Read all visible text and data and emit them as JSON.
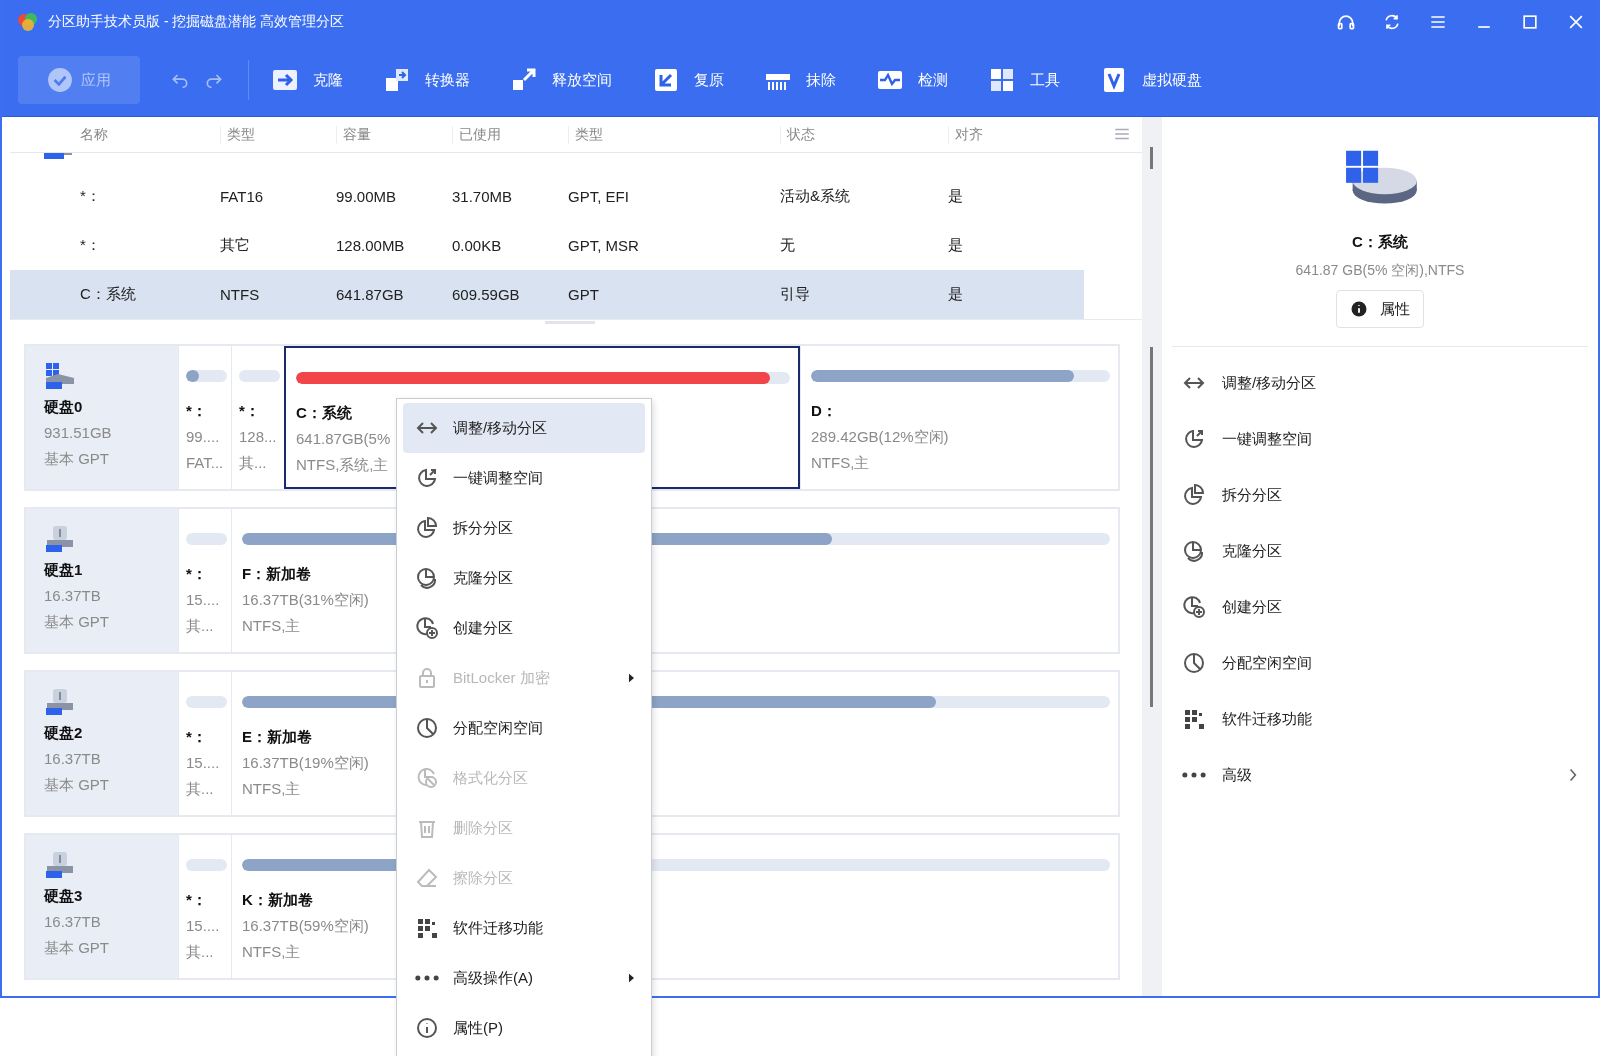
{
  "window": {
    "title": "分区助手技术员版 - 挖掘磁盘潜能 高效管理分区"
  },
  "toolbar": {
    "apply": {
      "label": "应用",
      "disabled": true
    },
    "tools": [
      {
        "label": "克隆"
      },
      {
        "label": "转换器"
      },
      {
        "label": "释放空间"
      },
      {
        "label": "复原"
      },
      {
        "label": "抹除"
      },
      {
        "label": "检测"
      },
      {
        "label": "工具"
      },
      {
        "label": "虚拟硬盘"
      }
    ]
  },
  "table": {
    "columns": [
      "名称",
      "类型",
      "容量",
      "已使用",
      "类型",
      "状态",
      "对齐"
    ],
    "rows": [
      {
        "cells": [
          "*：",
          "FAT16",
          "99.00MB",
          "31.70MB",
          "GPT, EFI",
          "活动&系统",
          "是"
        ],
        "selected": false
      },
      {
        "cells": [
          "*：",
          "其它",
          "128.00MB",
          "0.00KB",
          "GPT, MSR",
          "无",
          "是"
        ],
        "selected": false
      },
      {
        "cells": [
          "C：系统",
          "NTFS",
          "641.87GB",
          "609.59GB",
          "GPT",
          "引导",
          "是"
        ],
        "selected": true
      }
    ]
  },
  "disks": [
    {
      "name": "硬盘0",
      "size": "931.51GB",
      "style": "基本 GPT",
      "kind": "ssd",
      "partitions": [
        {
          "kind": "small",
          "name": "*：",
          "size": "99....",
          "info": "FAT...",
          "level": 0.32,
          "selected": false
        },
        {
          "kind": "small",
          "name": "*：",
          "size": "128...",
          "info": "其...",
          "selected": false
        },
        {
          "kind": "large",
          "name": "C：系统",
          "size": "641.87GB(5%",
          "info": "NTFS,系统,主",
          "level": 0.96,
          "selected": true
        },
        {
          "kind": "medium",
          "name": "D：",
          "size": "289.42GB(12%空闲)",
          "info": "NTFS,主",
          "level": 0.88,
          "selected": false
        }
      ]
    },
    {
      "name": "硬盘1",
      "size": "16.37TB",
      "style": "基本 GPT",
      "kind": "hdd",
      "partitions": [
        {
          "kind": "small",
          "name": "*：",
          "size": "15....",
          "info": "其...",
          "selected": false
        },
        {
          "kind": "full",
          "name": "F：新加卷",
          "size": "16.37TB(31%空闲)",
          "info": "NTFS,主",
          "level": 0.68,
          "selected": false
        }
      ]
    },
    {
      "name": "硬盘2",
      "size": "16.37TB",
      "style": "基本 GPT",
      "kind": "hdd",
      "partitions": [
        {
          "kind": "small",
          "name": "*：",
          "size": "15....",
          "info": "其...",
          "selected": false
        },
        {
          "kind": "full",
          "name": "E：新加卷",
          "size": "16.37TB(19%空闲)",
          "info": "NTFS,主",
          "level": 0.8,
          "selected": false
        }
      ]
    },
    {
      "name": "硬盘3",
      "size": "16.37TB",
      "style": "基本 GPT",
      "kind": "hdd",
      "partitions": [
        {
          "kind": "small",
          "name": "*：",
          "size": "15....",
          "info": "其...",
          "selected": false
        },
        {
          "kind": "full",
          "name": "K：新加卷",
          "size": "16.37TB(59%空闲)",
          "info": "NTFS,主",
          "level": 0.41,
          "selected": false
        }
      ]
    }
  ],
  "context_menu": {
    "items": [
      {
        "label": "调整/移动分区",
        "selected": true,
        "disabled": false,
        "submenu": false
      },
      {
        "label": "一键调整空间",
        "selected": false,
        "disabled": false,
        "submenu": false
      },
      {
        "label": "拆分分区",
        "selected": false,
        "disabled": false,
        "submenu": false
      },
      {
        "label": "克隆分区",
        "selected": false,
        "disabled": false,
        "submenu": false
      },
      {
        "label": "创建分区",
        "selected": false,
        "disabled": false,
        "submenu": false
      },
      {
        "label": "BitLocker 加密",
        "selected": false,
        "disabled": true,
        "submenu": true
      },
      {
        "label": "分配空闲空间",
        "selected": false,
        "disabled": false,
        "submenu": false
      },
      {
        "label": "格式化分区",
        "selected": false,
        "disabled": true,
        "submenu": false
      },
      {
        "label": "删除分区",
        "selected": false,
        "disabled": true,
        "submenu": false
      },
      {
        "label": "擦除分区",
        "selected": false,
        "disabled": true,
        "submenu": false
      },
      {
        "label": "软件迁移功能",
        "selected": false,
        "disabled": false,
        "submenu": false
      },
      {
        "label": "高级操作(A)",
        "selected": false,
        "disabled": false,
        "submenu": true
      },
      {
        "label": "属性(P)",
        "selected": false,
        "disabled": false,
        "submenu": false
      }
    ]
  },
  "side_panel": {
    "title": "C：系统",
    "subtitle": "641.87 GB(5% 空闲),NTFS",
    "button": "属性",
    "actions": [
      {
        "label": "调整/移动分区",
        "submenu": false
      },
      {
        "label": "一键调整空间",
        "submenu": false
      },
      {
        "label": "拆分分区",
        "submenu": false
      },
      {
        "label": "克隆分区",
        "submenu": false
      },
      {
        "label": "创建分区",
        "submenu": false
      },
      {
        "label": "分配空闲空间",
        "submenu": false
      },
      {
        "label": "软件迁移功能",
        "submenu": false
      },
      {
        "label": "高级",
        "submenu": true
      }
    ]
  }
}
